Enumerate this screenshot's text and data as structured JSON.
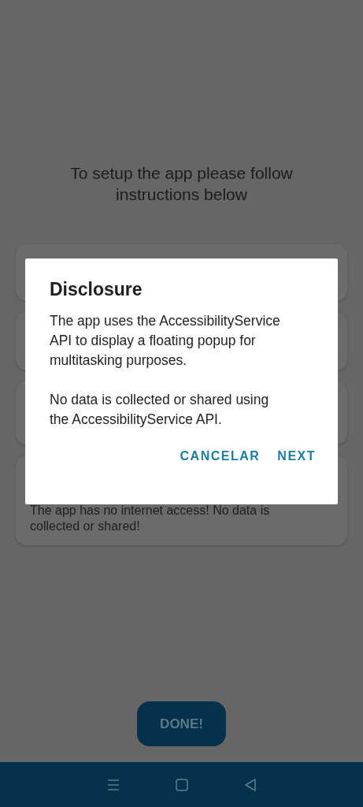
{
  "heading": "To setup the app please follow instructions below",
  "cards": [
    {
      "text": "The app has no internet access! No data is collected or shared!"
    }
  ],
  "done_button": "DONE!",
  "dialog": {
    "title": "Disclosure",
    "paragraphs": [
      "The app uses the AccessibilityService API to display a floating popup for multitasking purposes.",
      "No data is collected or shared using the AccessibilityService API."
    ],
    "buttons": [
      "CANCELAR",
      "NEXT"
    ]
  },
  "nav_bar": [
    {
      "kind": "menu"
    },
    {
      "kind": "home"
    },
    {
      "kind": "back"
    }
  ]
}
